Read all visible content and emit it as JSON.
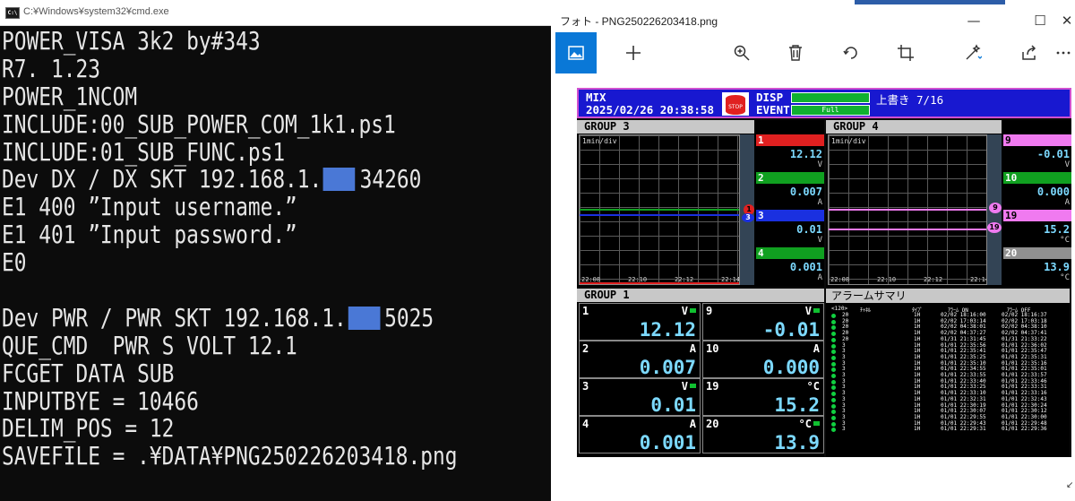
{
  "cmd": {
    "title": "C:¥Windows¥system32¥cmd.exe",
    "icon": "cmd-icon",
    "lines": [
      {
        "text": "POWER_VISA 3k2 by#343"
      },
      {
        "text": "R7. 1.23"
      },
      {
        "text": "POWER_1NCOM"
      },
      {
        "text": "INCLUDE:00_SUB_POWER_COM_1k1.ps1"
      },
      {
        "text": "INCLUDE:01_SUB_FUNC.ps1"
      },
      {
        "text": "Dev DX / DX SKT 192.168.1.",
        "masked": true,
        "after": "34260"
      },
      {
        "text": "E1 400 ”Input username.”"
      },
      {
        "text": "E1 401 ”Input password.”"
      },
      {
        "text": "E0"
      },
      {
        "text": ""
      },
      {
        "text": "Dev PWR / PWR SKT 192.168.1.",
        "masked": true,
        "after": "5025"
      },
      {
        "text": "QUE_CMD  PWR S VOLT 12.1"
      },
      {
        "text": "FCGET DATA SUB"
      },
      {
        "text": "INPUTBYE = 10466"
      },
      {
        "text": "DELIM_POS = 12"
      },
      {
        "text": "SAVEFILE = .¥DATA¥PNG250226203418.png"
      }
    ]
  },
  "photos": {
    "title": "フォト - PNG250226203418.png",
    "window_buttons": {
      "minimize": "—",
      "maximize": "☐",
      "close": "✕"
    },
    "toolbar": [
      {
        "name": "photo-icon",
        "active": true
      },
      {
        "name": "add-icon"
      },
      {
        "name": "zoom-icon"
      },
      {
        "name": "delete-icon"
      },
      {
        "name": "rotate-icon"
      },
      {
        "name": "crop-icon"
      },
      {
        "name": "edit-icon"
      },
      {
        "name": "share-icon"
      },
      {
        "name": "more-icon"
      }
    ],
    "accent": "#0a78d7"
  },
  "recorder": {
    "header": {
      "mode": "MIX",
      "datetime": "2025/02/26 20:38:58",
      "disp_label": "DISP",
      "event_label": "EVENT",
      "event_bar_text": "Full",
      "overwrite": "上書き 7/16"
    },
    "group3": {
      "title": "GROUP 3",
      "time_per_div": "1min/div",
      "time_labels": [
        "22:08",
        "22:10",
        "22:12",
        "22:14"
      ],
      "markers": [
        "1",
        "3"
      ],
      "channels": [
        {
          "num": "1",
          "color": "#e02020",
          "value": "12.12",
          "unit": "V"
        },
        {
          "num": "2",
          "color": "#10a020",
          "value": "0.007",
          "unit": "A"
        },
        {
          "num": "3",
          "color": "#1a30e0",
          "value": "0.01",
          "unit": "V"
        },
        {
          "num": "4",
          "color": "#10a020",
          "value": "0.001",
          "unit": "A"
        }
      ]
    },
    "group4": {
      "title": "GROUP 4",
      "time_per_div": "1min/div",
      "time_labels": [
        "22:08",
        "22:10",
        "22:12",
        "22:14"
      ],
      "markers": [
        "9",
        "19"
      ],
      "channels": [
        {
          "num": "9",
          "color": "#f07af0",
          "value": "-0.01",
          "unit": "V"
        },
        {
          "num": "10",
          "color": "#10a020",
          "value": "0.000",
          "unit": "A"
        },
        {
          "num": "19",
          "color": "#f07af0",
          "value": "15.2",
          "unit": "°C"
        },
        {
          "num": "20",
          "color": "#909090",
          "value": "13.9",
          "unit": "°C"
        }
      ]
    },
    "group1": {
      "title": "GROUP 1",
      "cells": [
        {
          "num": "1",
          "unit": "V",
          "value": "12.12",
          "alarm": true
        },
        {
          "num": "9",
          "unit": "V",
          "value": "-0.01",
          "alarm": true
        },
        {
          "num": "2",
          "unit": "A",
          "value": "0.007",
          "alarm": false
        },
        {
          "num": "10",
          "unit": "A",
          "value": "0.000",
          "alarm": false
        },
        {
          "num": "3",
          "unit": "V",
          "value": "0.01",
          "alarm": true
        },
        {
          "num": "19",
          "unit": "°C",
          "value": "15.2",
          "alarm": false
        },
        {
          "num": "4",
          "unit": "A",
          "value": "0.001",
          "alarm": false
        },
        {
          "num": "20",
          "unit": "°C",
          "value": "13.9",
          "alarm": true
        }
      ]
    },
    "alarm": {
      "title": "アラームサマリ",
      "head": {
        "count": "<120>",
        "channel": "ﾁｬﾈﾙ",
        "type": "ﾀｲﾌﾟ",
        "on": "ｱﾗｰﾑ ON",
        "off": "ｱﾗｰﾑ OFF"
      },
      "rows": [
        {
          "ch": "20",
          "type": "1H",
          "on": "02/02 18:16:00",
          "off": "02/02 18:16:37"
        },
        {
          "ch": "20",
          "type": "1H",
          "on": "02/02 17:03:14",
          "off": "02/02 17:03:18"
        },
        {
          "ch": "20",
          "type": "1H",
          "on": "02/02 04:38:01",
          "off": "02/02 04:38:10"
        },
        {
          "ch": "20",
          "type": "1H",
          "on": "02/02 04:37:27",
          "off": "02/02 04:37:41"
        },
        {
          "ch": "20",
          "type": "1H",
          "on": "01/31 21:31:45",
          "off": "01/31 21:33:22"
        },
        {
          "ch": "3",
          "type": "1H",
          "on": "01/01 22:35:56",
          "off": "01/01 22:36:02"
        },
        {
          "ch": "3",
          "type": "1H",
          "on": "01/01 22:35:41",
          "off": "01/01 22:35:47"
        },
        {
          "ch": "3",
          "type": "1H",
          "on": "01/01 22:35:25",
          "off": "01/01 22:35:31"
        },
        {
          "ch": "3",
          "type": "1H",
          "on": "01/01 22:35:10",
          "off": "01/01 22:35:16"
        },
        {
          "ch": "3",
          "type": "1H",
          "on": "01/01 22:34:55",
          "off": "01/01 22:35:01"
        },
        {
          "ch": "3",
          "type": "1H",
          "on": "01/01 22:33:55",
          "off": "01/01 22:33:57"
        },
        {
          "ch": "3",
          "type": "1H",
          "on": "01/01 22:33:40",
          "off": "01/01 22:33:46"
        },
        {
          "ch": "3",
          "type": "1H",
          "on": "01/01 22:33:25",
          "off": "01/01 22:33:31"
        },
        {
          "ch": "3",
          "type": "1H",
          "on": "01/01 22:33:10",
          "off": "01/01 22:33:16"
        },
        {
          "ch": "3",
          "type": "1H",
          "on": "01/01 22:32:31",
          "off": "01/01 22:32:43"
        },
        {
          "ch": "3",
          "type": "1H",
          "on": "01/01 22:30:19",
          "off": "01/01 22:30:24"
        },
        {
          "ch": "3",
          "type": "1H",
          "on": "01/01 22:30:07",
          "off": "01/01 22:30:12"
        },
        {
          "ch": "3",
          "type": "1H",
          "on": "01/01 22:29:55",
          "off": "01/01 22:30:00"
        },
        {
          "ch": "3",
          "type": "1H",
          "on": "01/01 22:29:43",
          "off": "01/01 22:29:48"
        },
        {
          "ch": "3",
          "type": "1H",
          "on": "01/01 22:29:31",
          "off": "01/01 22:29:36"
        }
      ]
    }
  }
}
